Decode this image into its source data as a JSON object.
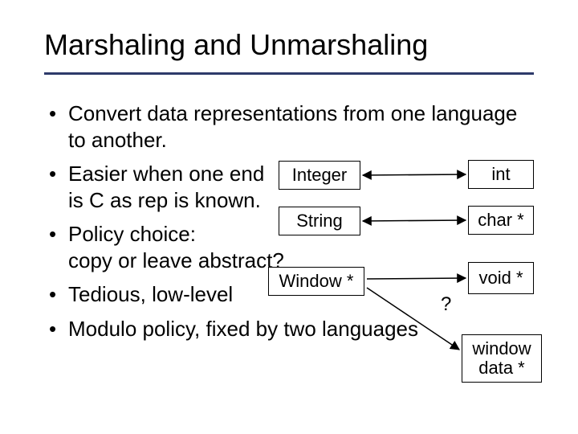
{
  "title": "Marshaling and Unmarshaling",
  "bullets": [
    "Convert data representations from one language to another.",
    "Easier when one end\nis C as rep is known.",
    "Policy choice:\ncopy or leave abstract?",
    "Tedious, low-level",
    "Modulo policy, fixed by two languages"
  ],
  "nodes": {
    "integer": "Integer",
    "int": "int",
    "string": "String",
    "charp": "char *",
    "windowp": "Window *",
    "voidp": "void *",
    "windowdata": "window data *"
  },
  "qmark": "?"
}
